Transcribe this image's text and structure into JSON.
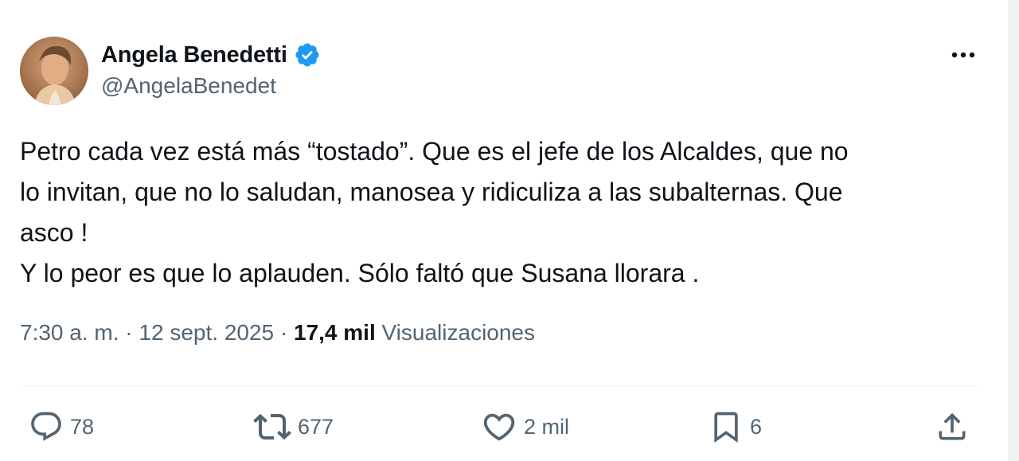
{
  "author": {
    "name": "Angela Benedetti",
    "handle": "@AngelaBenedet",
    "verified": true
  },
  "tweet": {
    "text": "Petro cada vez está más “tostado”. Que es el jefe de los Alcaldes, que no\nlo invitan, que no lo saludan, manosea y ridiculiza a las subalternas. Que\nasco !\nY lo peor es que lo aplauden. Sólo faltó que Susana llorara ."
  },
  "meta": {
    "time": "7:30 a. m.",
    "separator": " · ",
    "date": "12 sept. 2025",
    "views_count": "17,4 mil",
    "views_label": "Visualizaciones"
  },
  "actions": {
    "replies": "78",
    "reposts": "677",
    "likes": "2 mil",
    "bookmarks": "6"
  },
  "icons": {
    "more": "more-horizontal-icon",
    "reply": "reply-bubble-icon",
    "repost": "repost-icon",
    "like": "heart-icon",
    "bookmark": "bookmark-icon",
    "share": "share-upload-icon"
  },
  "colors": {
    "text": "#0f1419",
    "secondary": "#536471",
    "verified": "#1d9bf0",
    "divider": "#eff3f4"
  }
}
